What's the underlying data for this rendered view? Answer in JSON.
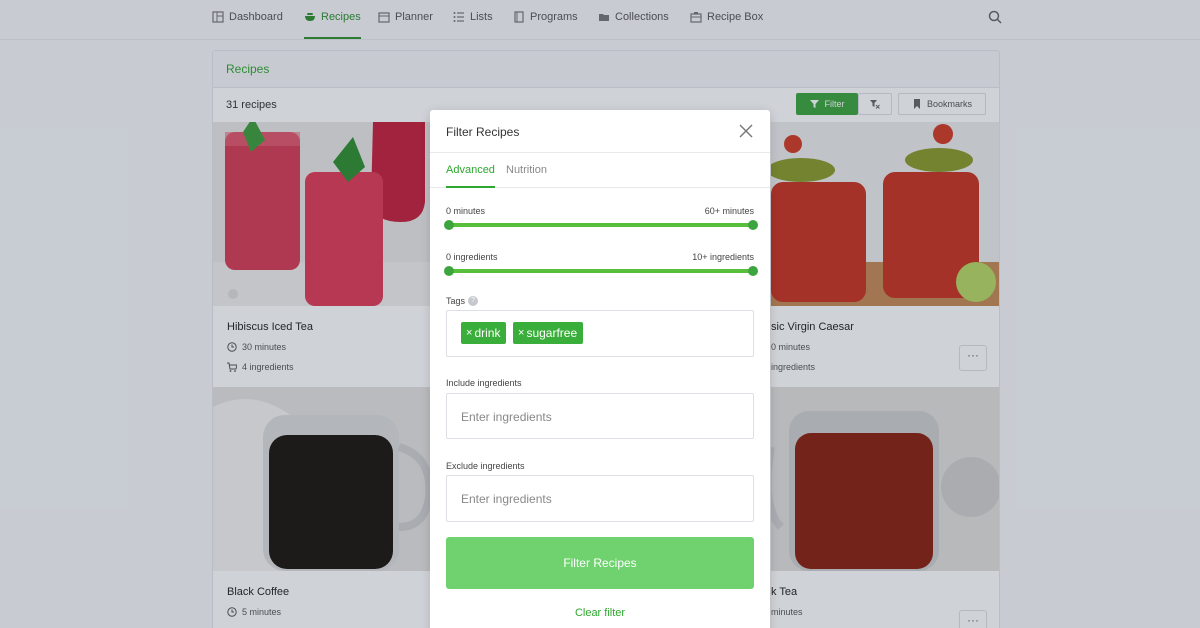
{
  "nav": {
    "items": [
      {
        "label": "Dashboard",
        "icon": "dashboard-icon"
      },
      {
        "label": "Recipes",
        "icon": "bowl-icon"
      },
      {
        "label": "Planner",
        "icon": "calendar-icon"
      },
      {
        "label": "Lists",
        "icon": "list-icon"
      },
      {
        "label": "Programs",
        "icon": "book-icon"
      },
      {
        "label": "Collections",
        "icon": "folder-icon"
      },
      {
        "label": "Recipe Box",
        "icon": "box-icon"
      }
    ],
    "active": "Recipes"
  },
  "recipes_panel": {
    "title": "Recipes",
    "count_label": "31 recipes",
    "filter_label": "Filter",
    "bookmarks_label": "Bookmarks"
  },
  "recipes": [
    {
      "title": "Hibiscus Iced Tea",
      "time": "30 minutes",
      "ingredients": "4 ingredients"
    },
    {
      "title": "sic Virgin Caesar",
      "time": "0 minutes",
      "ingredients": "ingredients"
    },
    {
      "title": "Black Coffee",
      "time": "5 minutes",
      "ingredients": ""
    },
    {
      "title": "k Tea",
      "time": "minutes",
      "ingredients": ""
    }
  ],
  "modal": {
    "title": "Filter Recipes",
    "tabs": [
      "Advanced",
      "Nutrition"
    ],
    "active_tab": "Advanced",
    "time_range": {
      "min_label": "0 minutes",
      "max_label": "60+ minutes",
      "low": 0,
      "high": 60
    },
    "ingredient_range": {
      "min_label": "0 ingredients",
      "max_label": "10+ ingredients",
      "low": 0,
      "high": 10
    },
    "tags_label": "Tags",
    "tags": [
      "drink",
      "sugarfree"
    ],
    "include_label": "Include ingredients",
    "include_placeholder": "Enter ingredients",
    "exclude_label": "Exclude ingredients",
    "exclude_placeholder": "Enter ingredients",
    "submit_label": "Filter Recipes",
    "clear_label": "Clear filter"
  },
  "colors": {
    "accent": "#3da53d",
    "submit": "#6fd26f"
  }
}
